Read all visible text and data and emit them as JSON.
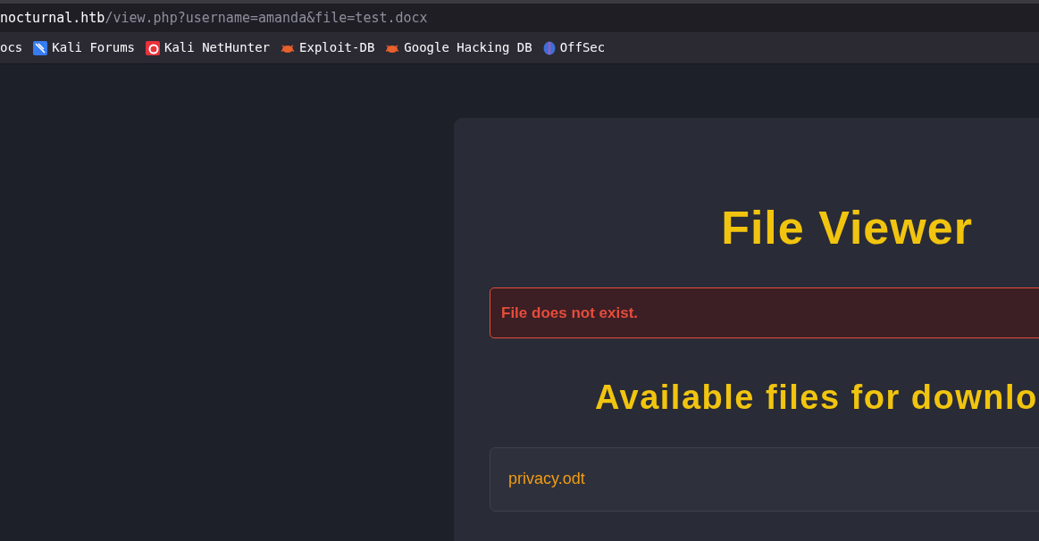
{
  "address_bar": {
    "host": "nocturnal.htb",
    "path": "/view.php?username=amanda&file=test.docx"
  },
  "bookmarks": [
    {
      "label": "ocs",
      "kind": "none"
    },
    {
      "label": "Kali Forums",
      "kind": "kali"
    },
    {
      "label": "Kali NetHunter",
      "kind": "nethunter"
    },
    {
      "label": "Exploit-DB",
      "kind": "bug"
    },
    {
      "label": "Google Hacking DB",
      "kind": "bug"
    },
    {
      "label": "OffSec",
      "kind": "offsec"
    }
  ],
  "page": {
    "title": "File Viewer",
    "error": "File does not exist.",
    "files_heading": "Available files for downlo",
    "files": [
      "privacy.odt"
    ]
  }
}
